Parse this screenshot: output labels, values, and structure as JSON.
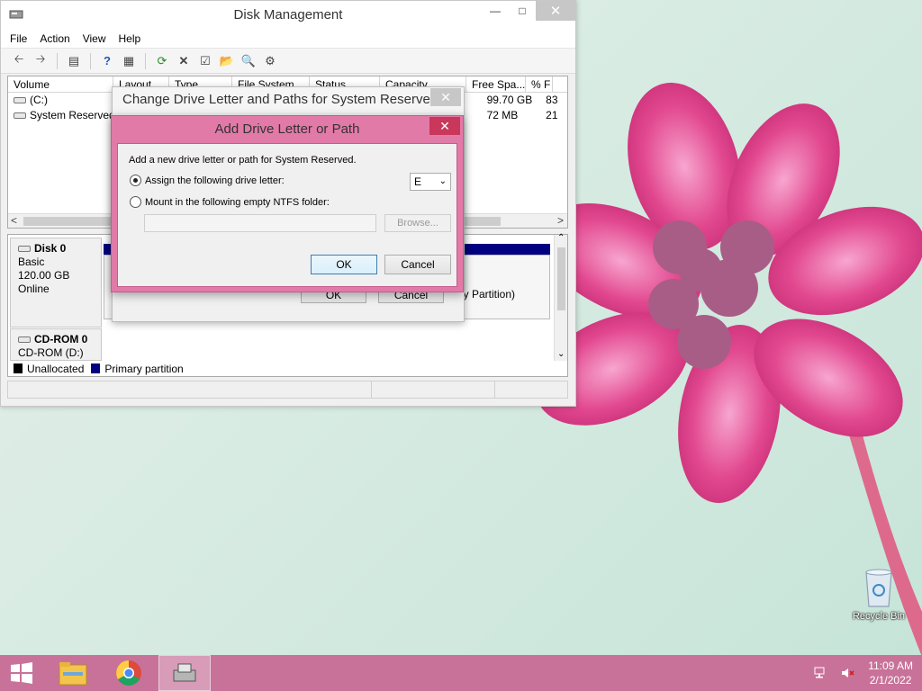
{
  "window": {
    "title": "Disk Management",
    "menu": [
      "File",
      "Action",
      "View",
      "Help"
    ]
  },
  "volume_list": {
    "columns": [
      "Volume",
      "Layout",
      "Type",
      "File System",
      "Status",
      "Capacity",
      "Free Spa...",
      "% F"
    ],
    "rows": [
      {
        "volume": "(C:)",
        "free": "99.70 GB",
        "pct": "83"
      },
      {
        "volume": "System Reserved",
        "free": "72 MB",
        "pct": "21"
      }
    ]
  },
  "disks": [
    {
      "name": "Disk 0",
      "type": "Basic",
      "size": "120.00 GB",
      "status": "Online"
    },
    {
      "name": "CD-ROM 0",
      "type": "CD-ROM (D:)"
    }
  ],
  "partition_partial_text": "ary Partition)",
  "legend": {
    "unallocated": "Unallocated",
    "primary": "Primary partition",
    "unallocated_color": "#000000",
    "primary_color": "#000080"
  },
  "change_dialog": {
    "title": "Change Drive Letter and Paths for System Reserved",
    "ok": "OK",
    "cancel": "Cancel"
  },
  "add_dialog": {
    "title": "Add Drive Letter or Path",
    "description": "Add a new drive letter or path for System Reserved.",
    "option_assign": "Assign the following drive letter:",
    "option_mount": "Mount in the following empty NTFS folder:",
    "drive_letter": "E",
    "browse": "Browse...",
    "ok": "OK",
    "cancel": "Cancel",
    "accent_color": "#e27aa8"
  },
  "desktop": {
    "recycle_bin": "Recycle Bin"
  },
  "taskbar": {
    "color": "#c8729a",
    "time": "11:09 AM",
    "date": "2/1/2022"
  }
}
